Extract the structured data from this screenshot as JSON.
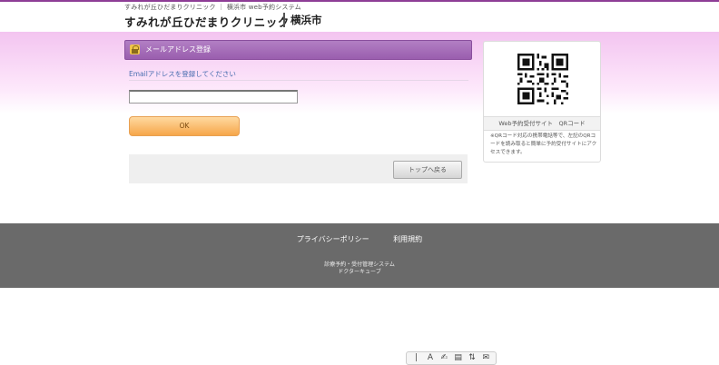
{
  "header": {
    "breadcrumb": "すみれが丘ひだまりクリニック ｜ 横浜市 web予約システム",
    "title": "すみれが丘ひだまりクリニック",
    "city": "横浜市"
  },
  "panel": {
    "title": "メールアドレス登録",
    "instruction": "Emailアドレスを登録してください",
    "email_placeholder": "",
    "ok_label": "OK",
    "top_label": "トップへ戻る"
  },
  "sidebar": {
    "qr_caption": "Web予約受付サイト　QRコード",
    "qr_description": "※QRコード対応の携帯電話等で、左記のQRコードを読み取ると簡単に予約受付サイトにアクセスできます。"
  },
  "footer": {
    "links": [
      "プライバシーポリシー",
      "利用規約"
    ],
    "copyright_line1": "診療予約・受付管理システム",
    "copyright_line2": "ドクターキューブ"
  },
  "colors": {
    "accent_purple": "#9a5eae",
    "ok_orange": "#f6a64a",
    "footer_gray": "#6a6a6a"
  },
  "toolbar": {
    "icons": [
      "cursor-icon",
      "text-size-icon",
      "speech-icon",
      "page-icon",
      "translate-icon",
      "mail-icon"
    ]
  }
}
